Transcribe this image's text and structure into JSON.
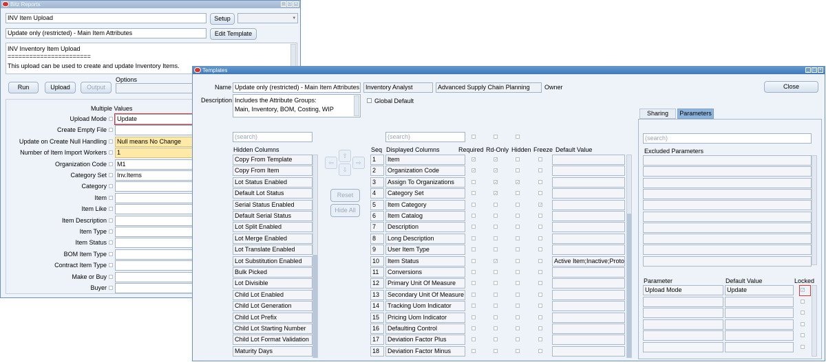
{
  "back_window": {
    "title": "Bitz Reports",
    "template_field": "INV Item Upload",
    "setup_button": "Setup",
    "description_field": "Update only (restricted) - Main Item Attributes",
    "edit_template_button": "Edit Template",
    "info_lines": [
      "INV Inventory Item Upload",
      "=======================",
      "This upload can be used to create and update Inventory Items."
    ],
    "run_button": "Run",
    "upload_button": "Upload",
    "output_button": "Output",
    "options_label": "Options",
    "multiple_values_label": "Multiple Values",
    "params": [
      {
        "label": "Upload Mode",
        "value": "Update",
        "style": "white"
      },
      {
        "label": "Create Empty File",
        "value": "",
        "style": "white"
      },
      {
        "label": "Update on Create Null Handling",
        "value": "Null means No Change",
        "style": "yellow"
      },
      {
        "label": "Number of Item Import Workers",
        "value": "1",
        "style": "yellow"
      },
      {
        "label": "Organization Code",
        "value": "M1",
        "style": "white"
      },
      {
        "label": "Category Set",
        "value": "Inv.Items",
        "style": "white"
      },
      {
        "label": "Category",
        "value": "",
        "style": "white"
      },
      {
        "label": "Item",
        "value": "",
        "style": "white"
      },
      {
        "label": "Item Like",
        "value": "",
        "style": "white"
      },
      {
        "label": "Item Description",
        "value": "",
        "style": "white"
      },
      {
        "label": "Item Type",
        "value": "",
        "style": "white"
      },
      {
        "label": "Item Status",
        "value": "",
        "style": "white"
      },
      {
        "label": "BOM Item Type",
        "value": "",
        "style": "white"
      },
      {
        "label": "Contract Item Type",
        "value": "",
        "style": "white"
      },
      {
        "label": "Make or Buy",
        "value": "",
        "style": "white"
      },
      {
        "label": "Buyer",
        "value": "",
        "style": "white"
      }
    ]
  },
  "templates": {
    "title": "Templates",
    "name_label": "Name",
    "name_value": "Update only (restricted) - Main Item Attributes",
    "responsibility": "Inventory Analyst",
    "application": "Advanced Supply Chain Planning",
    "owner_label": "Owner",
    "close_button": "Close",
    "description_label": "Description",
    "description_lines": [
      "Includes the Attribute Groups:",
      "Main, Inventory, BOM, Costing, WIP"
    ],
    "global_default_label": "Global Default",
    "search_placeholder": "(search)",
    "hidden_columns_header": "Hidden Columns",
    "hidden_columns": [
      "Copy From Template",
      "Copy From Item",
      "Lot Status Enabled",
      "Default Lot Status",
      "Serial Status Enabled",
      "Default Serial Status",
      "Lot Split Enabled",
      "Lot Merge Enabled",
      "Lot Translate Enabled",
      "Lot Substitution Enabled",
      "Bulk Picked",
      "Lot Divisible",
      "Child Lot Enabled",
      "Child Lot Generation",
      "Child Lot Prefix",
      "Child Lot Starting Number",
      "Child Lot Format Validation",
      "Maturity Days"
    ],
    "reset_button": "Reset",
    "hide_all_button": "Hide All",
    "headers": {
      "seq": "Seq",
      "displayed": "Displayed Columns",
      "required": "Required",
      "rdonly": "Rd-Only",
      "hidden": "Hidden",
      "freeze": "Freeze",
      "default": "Default Value"
    },
    "rows": [
      {
        "seq": "1",
        "name": "Item",
        "required": true,
        "rdonly": true,
        "hidden": false,
        "freeze": false,
        "default": ""
      },
      {
        "seq": "2",
        "name": "Organization Code",
        "required": true,
        "rdonly": true,
        "hidden": false,
        "freeze": false,
        "default": ""
      },
      {
        "seq": "3",
        "name": "Assign To Organizations",
        "required": false,
        "rdonly": true,
        "hidden": true,
        "freeze": false,
        "default": ""
      },
      {
        "seq": "4",
        "name": "Category Set",
        "required": false,
        "rdonly": true,
        "hidden": false,
        "freeze": false,
        "default": ""
      },
      {
        "seq": "5",
        "name": "Item Category",
        "required": false,
        "rdonly": false,
        "hidden": false,
        "freeze": true,
        "default": ""
      },
      {
        "seq": "6",
        "name": "Item Catalog",
        "required": false,
        "rdonly": false,
        "hidden": false,
        "freeze": false,
        "default": ""
      },
      {
        "seq": "7",
        "name": "Description",
        "required": false,
        "rdonly": false,
        "hidden": false,
        "freeze": false,
        "default": ""
      },
      {
        "seq": "8",
        "name": "Long Description",
        "required": false,
        "rdonly": false,
        "hidden": false,
        "freeze": false,
        "default": ""
      },
      {
        "seq": "9",
        "name": "User Item Type",
        "required": false,
        "rdonly": false,
        "hidden": false,
        "freeze": false,
        "default": ""
      },
      {
        "seq": "10",
        "name": "Item Status",
        "required": false,
        "rdonly": true,
        "hidden": false,
        "freeze": false,
        "default": "Active Item;Inactive;Prototype"
      },
      {
        "seq": "11",
        "name": "Conversions",
        "required": false,
        "rdonly": false,
        "hidden": false,
        "freeze": false,
        "default": ""
      },
      {
        "seq": "12",
        "name": "Primary Unit Of Measure",
        "required": false,
        "rdonly": false,
        "hidden": false,
        "freeze": false,
        "default": ""
      },
      {
        "seq": "13",
        "name": "Secondary Unit Of Measure",
        "required": false,
        "rdonly": false,
        "hidden": false,
        "freeze": false,
        "default": ""
      },
      {
        "seq": "14",
        "name": "Tracking Uom Indicator",
        "required": false,
        "rdonly": false,
        "hidden": false,
        "freeze": false,
        "default": ""
      },
      {
        "seq": "15",
        "name": "Pricing Uom Indicator",
        "required": false,
        "rdonly": false,
        "hidden": false,
        "freeze": false,
        "default": ""
      },
      {
        "seq": "16",
        "name": "Defaulting Control",
        "required": false,
        "rdonly": false,
        "hidden": false,
        "freeze": false,
        "default": ""
      },
      {
        "seq": "17",
        "name": "Deviation Factor Plus",
        "required": false,
        "rdonly": false,
        "hidden": false,
        "freeze": false,
        "default": ""
      },
      {
        "seq": "18",
        "name": "Deviation Factor Minus",
        "required": false,
        "rdonly": false,
        "hidden": false,
        "freeze": false,
        "default": ""
      }
    ],
    "tabs": [
      "Sharing",
      "Parameters"
    ],
    "excluded_parameters_label": "Excluded Parameters",
    "param_headers": {
      "parameter": "Parameter",
      "default_value": "Default Value",
      "locked": "Locked"
    },
    "param_rows": [
      {
        "parameter": "Upload Mode",
        "default_value": "Update",
        "locked": true
      }
    ]
  },
  "colors": {
    "title_active": "#3f79b8",
    "highlight_red": "#e0352f",
    "required_yellow": "#ffe9a6"
  }
}
